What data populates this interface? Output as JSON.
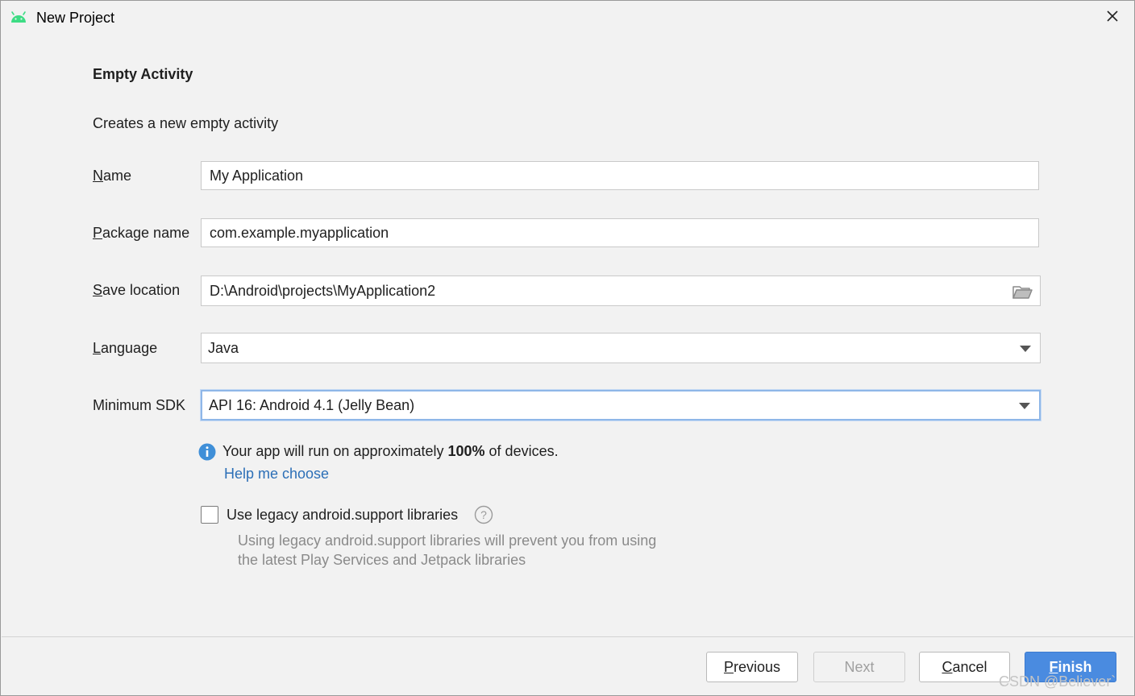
{
  "window": {
    "title": "New Project"
  },
  "template": {
    "heading": "Empty Activity",
    "description": "Creates a new empty activity"
  },
  "form": {
    "name": {
      "label_mnemonic": "N",
      "label_rest": "ame",
      "value": "My Application"
    },
    "package_name": {
      "label_mnemonic": "P",
      "label_rest": "ackage name",
      "value": "com.example.myapplication"
    },
    "save_location": {
      "label_mnemonic": "S",
      "label_rest": "ave location",
      "value": "D:\\Android\\projects\\MyApplication2"
    },
    "language": {
      "label_mnemonic": "L",
      "label_rest": "anguage",
      "selected": "Java"
    },
    "minimum_sdk": {
      "label": "Minimum SDK",
      "selected": "API 16: Android 4.1 (Jelly Bean)"
    }
  },
  "info": {
    "text_before": "Your app will run on approximately ",
    "percent": "100%",
    "text_after": " of devices.",
    "help_link": "Help me choose"
  },
  "legacy": {
    "checkbox_label": "Use legacy android.support libraries",
    "checked": false,
    "note_line1": "Using legacy android.support libraries will prevent you from using",
    "note_line2": "the latest Play Services and Jetpack libraries"
  },
  "buttons": {
    "previous": {
      "mnemonic": "P",
      "rest": "revious"
    },
    "next": "Next",
    "cancel": {
      "mnemonic": "C",
      "rest": "ancel"
    },
    "finish": {
      "mnemonic": "F",
      "rest": "inish"
    }
  },
  "watermark": "CSDN @Believer`",
  "colors": {
    "accent": "#4a8be0",
    "link": "#2c6fb7",
    "android_green": "#3ddc84",
    "info_blue": "#3f8fd8"
  },
  "icons": [
    "android-icon",
    "close-icon",
    "folder-icon",
    "chevron-down-icon",
    "info-icon",
    "question-icon"
  ]
}
